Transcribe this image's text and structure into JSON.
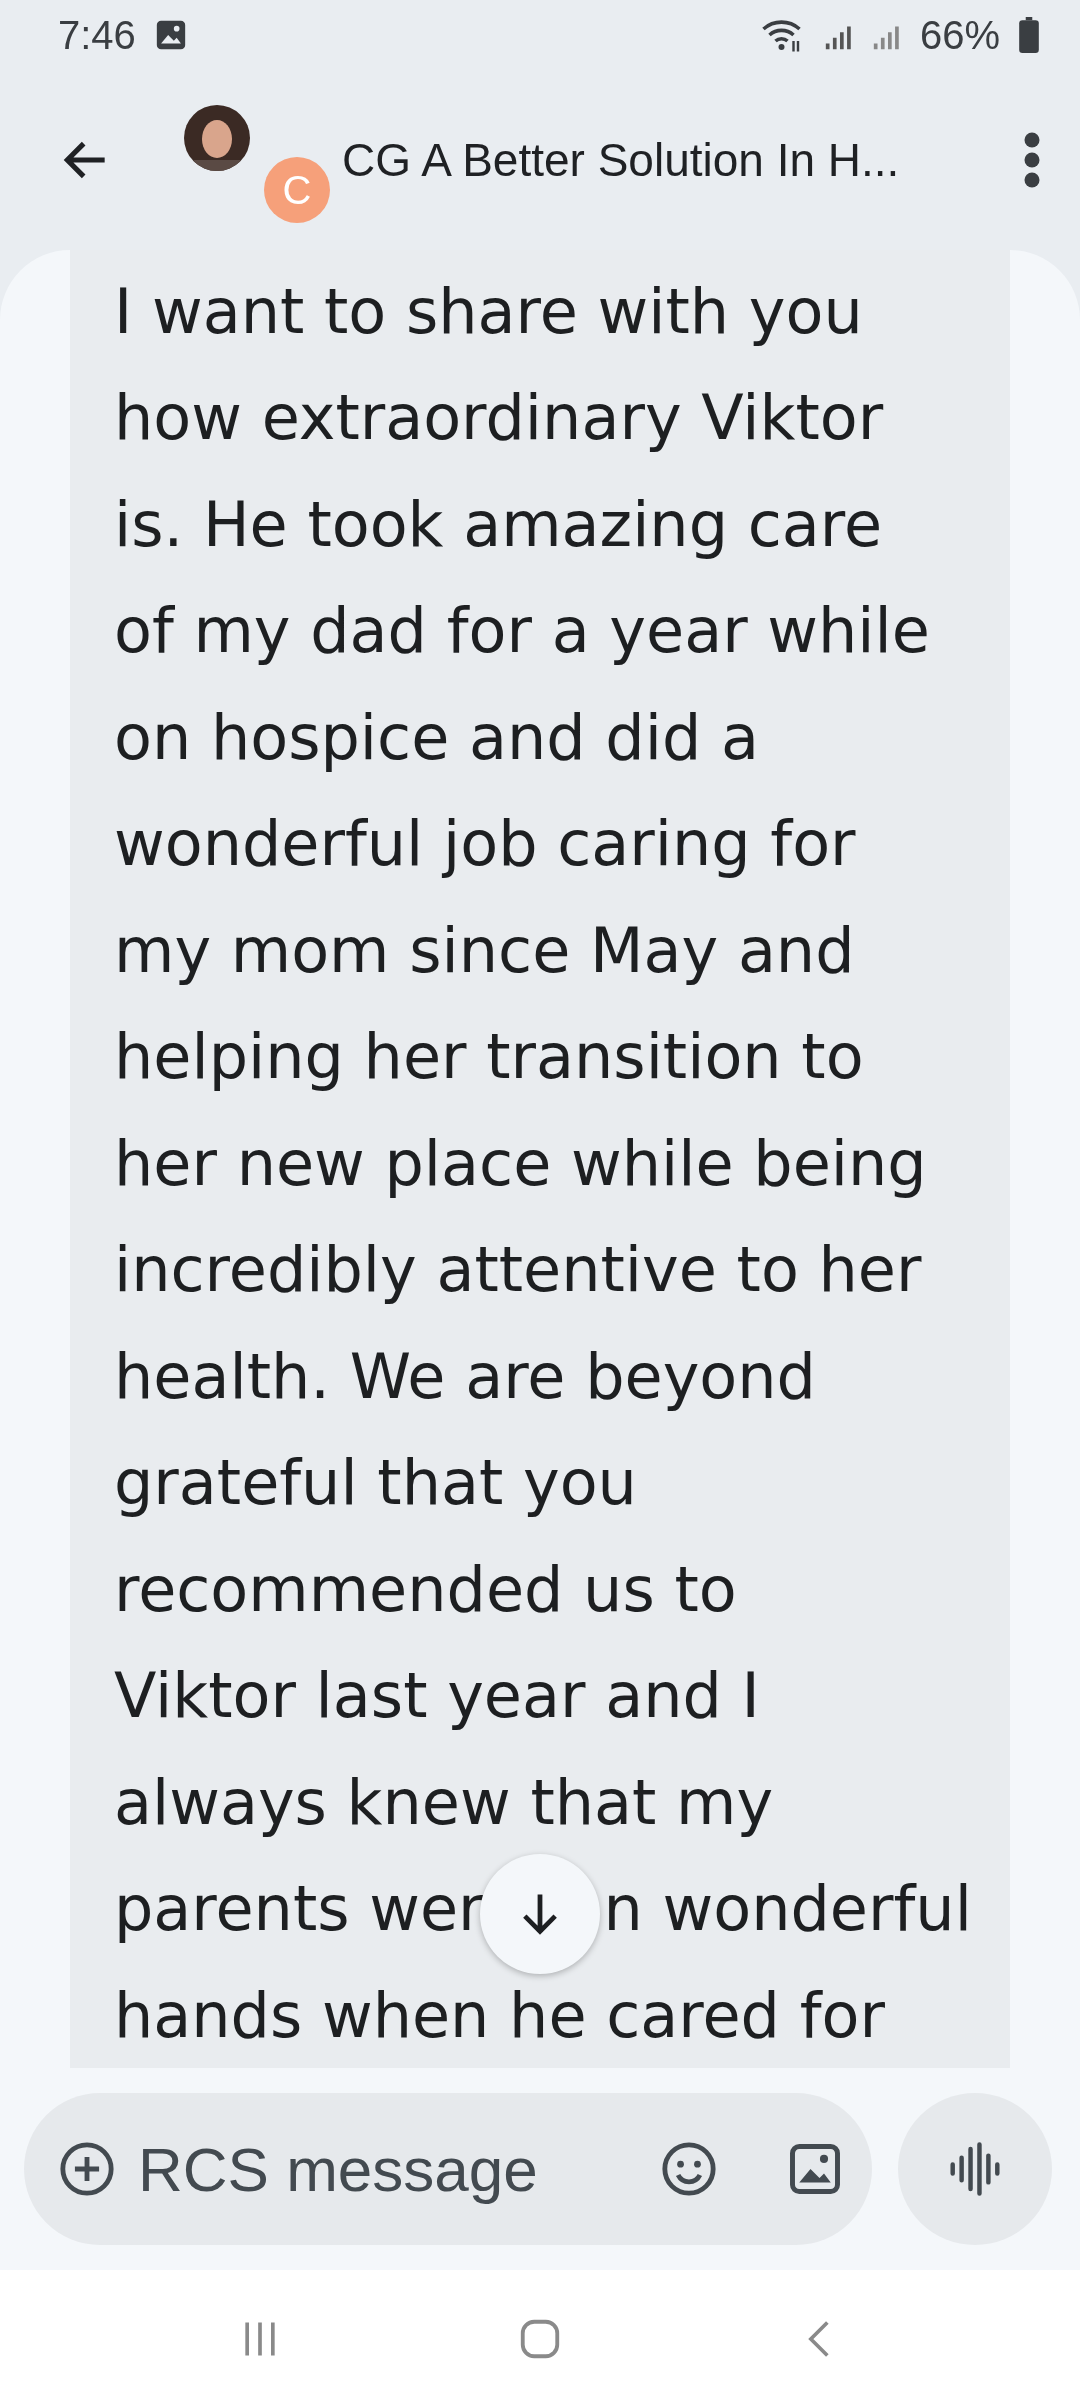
{
  "status_bar": {
    "time": "7:46",
    "battery": "66%"
  },
  "header": {
    "title": "CG A Better Solution In H...",
    "avatar_letter": "C"
  },
  "message": {
    "lines": [
      [
        "I want to share with you"
      ],
      [
        "how extraordinary Viktor"
      ],
      [
        "is. He took amazing care"
      ],
      [
        "of my dad for a year while"
      ],
      [
        "on hospice and did a"
      ],
      [
        "wonderful job caring for"
      ],
      [
        "my mom since May and"
      ],
      [
        "helping her transition to"
      ],
      [
        "her new place while being"
      ],
      [
        "incredibly attentive to her"
      ],
      [
        "health. We are beyond"
      ],
      [
        "grateful that you"
      ],
      [
        "recommended us to"
      ],
      [
        "Viktor last year and I"
      ],
      [
        "always knew that my"
      ],
      [
        "parents wer",
        "n wonderful"
      ],
      [
        "hands when he cared for"
      ]
    ]
  },
  "compose": {
    "placeholder": "RCS message"
  }
}
